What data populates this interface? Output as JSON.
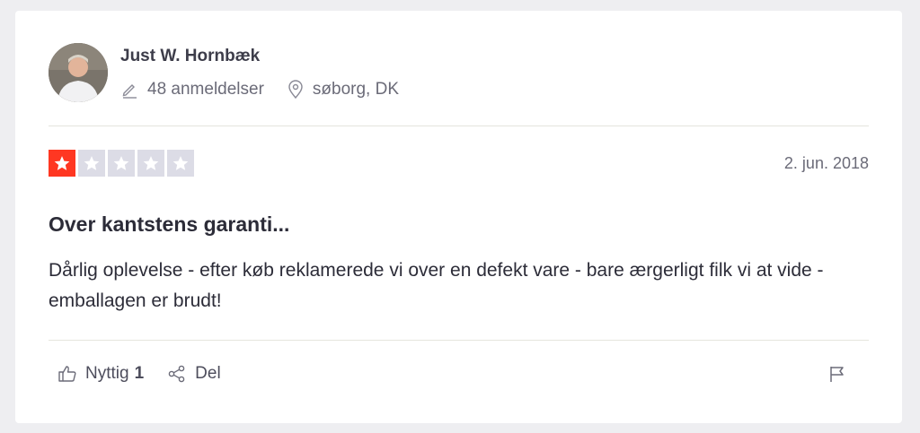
{
  "reviewer": {
    "name": "Just W. Hornbæk",
    "reviews_count": "48 anmeldelser",
    "location": "søborg, DK"
  },
  "review": {
    "rating": 1,
    "max_rating": 5,
    "date": "2. jun. 2018",
    "title": "Over kantstens garanti...",
    "body": "Dårlig oplevelse - efter køb reklamerede vi over en defekt vare - bare ærgerligt filk vi at vide - emballagen er brudt!"
  },
  "actions": {
    "useful_label": "Nyttig",
    "useful_count": "1",
    "share_label": "Del"
  },
  "icons": {
    "reviews": "pencil-icon",
    "location": "location-pin-icon",
    "useful": "thumbs-up-icon",
    "share": "share-icon",
    "report": "flag-icon",
    "star": "star-icon"
  },
  "colors": {
    "star_filled": "#ff3722",
    "star_empty": "#dcdce6"
  }
}
